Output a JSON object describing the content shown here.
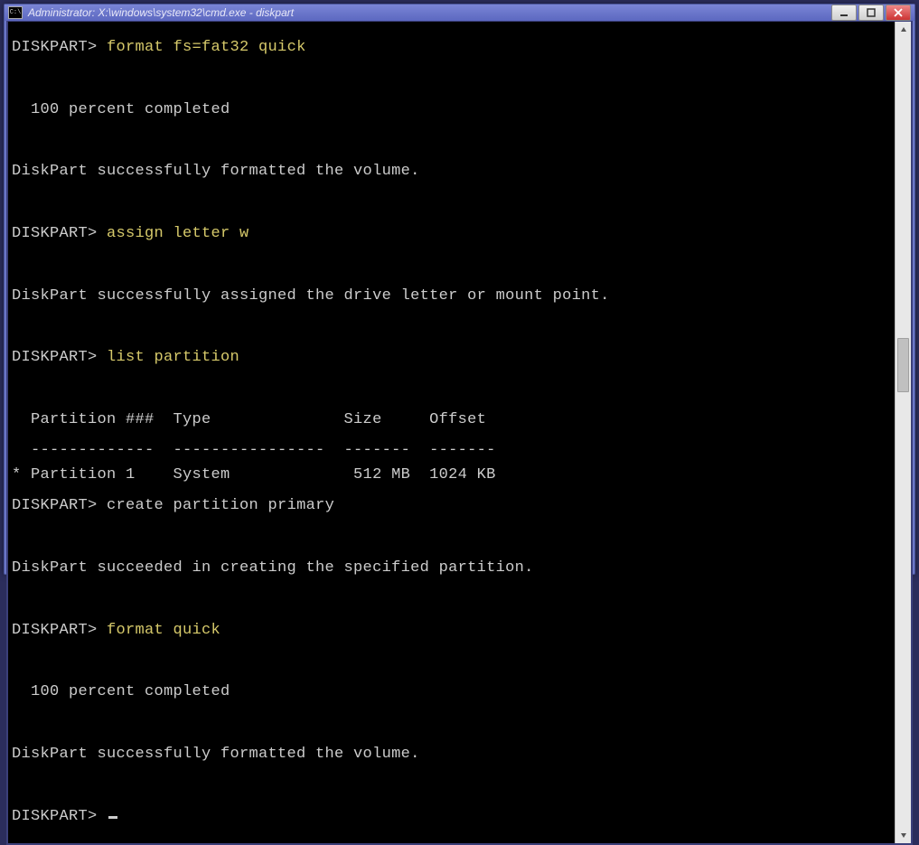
{
  "window": {
    "title": "Administrator: X:\\windows\\system32\\cmd.exe - diskpart",
    "icon_label": "C:\\"
  },
  "term": {
    "prompt": "DISKPART>",
    "cmd1": "format fs=fat32 quick",
    "out1a": "  100 percent completed",
    "out1b": "DiskPart successfully formatted the volume.",
    "cmd2": "assign letter w",
    "out2": "DiskPart successfully assigned the drive letter or mount point.",
    "cmd3": "list partition",
    "table_header": "  Partition ###  Type              Size     Offset",
    "table_divider": "  -------------  ----------------  -------  -------",
    "table_row1": "* Partition 1    System             512 MB  1024 KB",
    "cmd4": "create partition primary",
    "out4": "DiskPart succeeded in creating the specified partition.",
    "cmd5": "format quick",
    "out5a": "  100 percent completed",
    "out5b": "DiskPart successfully formatted the volume."
  }
}
